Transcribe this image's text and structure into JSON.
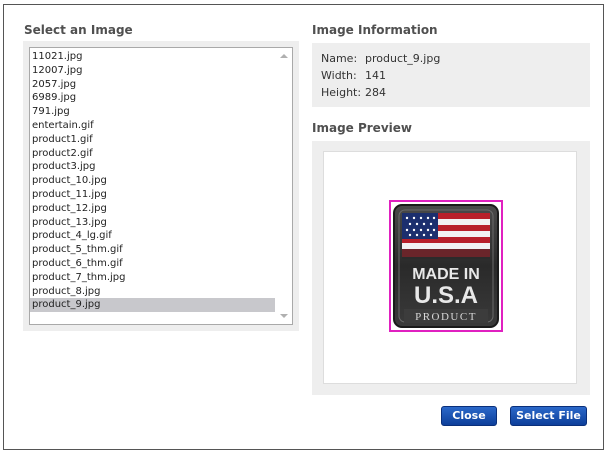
{
  "sections": {
    "select_title": "Select an Image",
    "info_title": "Image Information",
    "preview_title": "Image Preview"
  },
  "file_list": {
    "items": [
      "11021.jpg",
      "12007.jpg",
      "2057.jpg",
      "6989.jpg",
      "791.jpg",
      "entertain.gif",
      "product1.gif",
      "product2.gif",
      "product3.jpg",
      "product_10.jpg",
      "product_11.jpg",
      "product_12.jpg",
      "product_13.jpg",
      "product_4_lg.gif",
      "product_5_thm.gif",
      "product_6_thm.gif",
      "product_7_thm.jpg",
      "product_8.jpg",
      "product_9.jpg"
    ],
    "selected_index": 18
  },
  "info": {
    "name_label": "Name:",
    "name_value": "product_9.jpg",
    "width_label": "Width:",
    "width_value": "141",
    "height_label": "Height:",
    "height_value": "284"
  },
  "preview": {
    "line1": "MADE IN",
    "line2": "U.S.A",
    "line3": "PRODUCT",
    "highlight_color": "#e020c0"
  },
  "buttons": {
    "close": "Close",
    "select_file": "Select File"
  }
}
